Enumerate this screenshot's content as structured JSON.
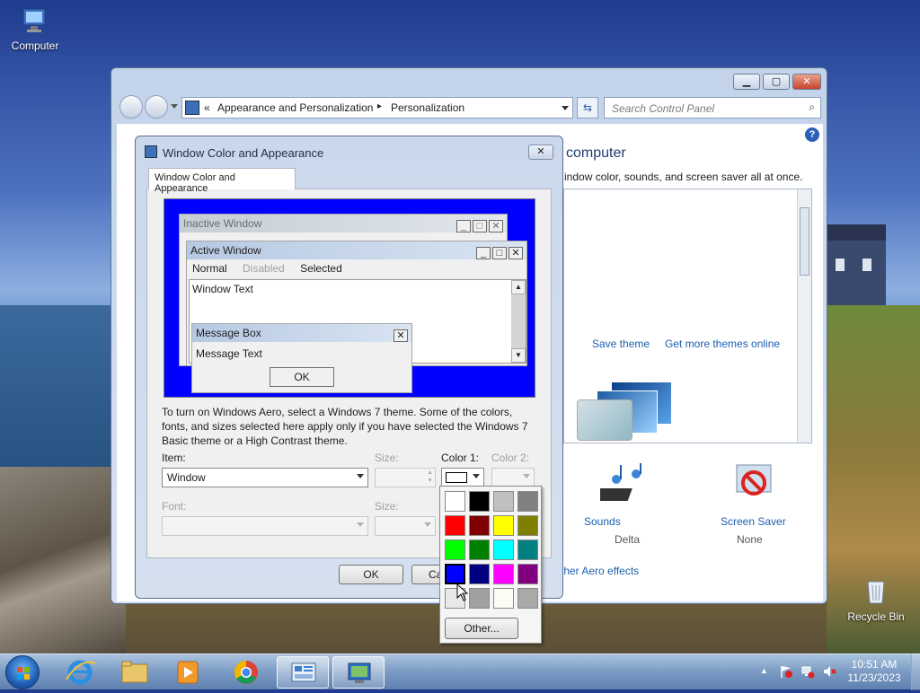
{
  "desktop": {
    "computer_label": "Computer",
    "recycle_label": "Recycle Bin"
  },
  "cp_window": {
    "breadcrumb_prefix": "«",
    "breadcrumb_1": "Appearance and Personalization",
    "breadcrumb_sep": "▸",
    "breadcrumb_2": "Personalization",
    "search_placeholder": "Search Control Panel",
    "heading_partial": "computer",
    "subtext_partial": "indow color, sounds, and screen saver all at once.",
    "save_theme": "Save theme",
    "more_themes": "Get more themes online",
    "sounds_label": "Sounds",
    "sounds_value": "Delta",
    "saver_label": "Screen Saver",
    "saver_value": "None",
    "aero_link_partial": "ther Aero effects"
  },
  "dialog": {
    "title": "Window Color and Appearance",
    "tab": "Window Color and Appearance",
    "preview": {
      "inactive": "Inactive Window",
      "active": "Active Window",
      "menu_normal": "Normal",
      "menu_disabled": "Disabled",
      "menu_selected": "Selected",
      "window_text": "Window Text",
      "msgbox_title": "Message Box",
      "msgbox_text": "Message Text",
      "msgbox_ok": "OK"
    },
    "info": "To turn on Windows Aero, select a Windows 7 theme.  Some of the colors, fonts, and sizes selected here apply only if you have selected the Windows 7 Basic theme or a High Contrast theme.",
    "item_label": "Item:",
    "item_value": "Window",
    "size_label": "Size:",
    "color1_label": "Color 1:",
    "color2_label": "Color 2:",
    "font_label": "Font:",
    "font_size_label": "Size:",
    "ok": "OK",
    "cancel_partial": "Ca"
  },
  "palette": {
    "colors": [
      "#ffffff",
      "#000000",
      "#c0c0c0",
      "#808080",
      "#ff0000",
      "#800000",
      "#ffff00",
      "#808000",
      "#00ff00",
      "#008000",
      "#00ffff",
      "#008080",
      "#0000ff",
      "#000080",
      "#ff00ff",
      "#800080",
      "#e8e8e8",
      "#a0a0a0",
      "#fdfcf4",
      "#a9a9a9"
    ],
    "selected": "#0000ff",
    "other": "Other..."
  },
  "taskbar": {
    "time": "10:51 AM",
    "date": "11/23/2023",
    "show_hidden": "▲"
  }
}
